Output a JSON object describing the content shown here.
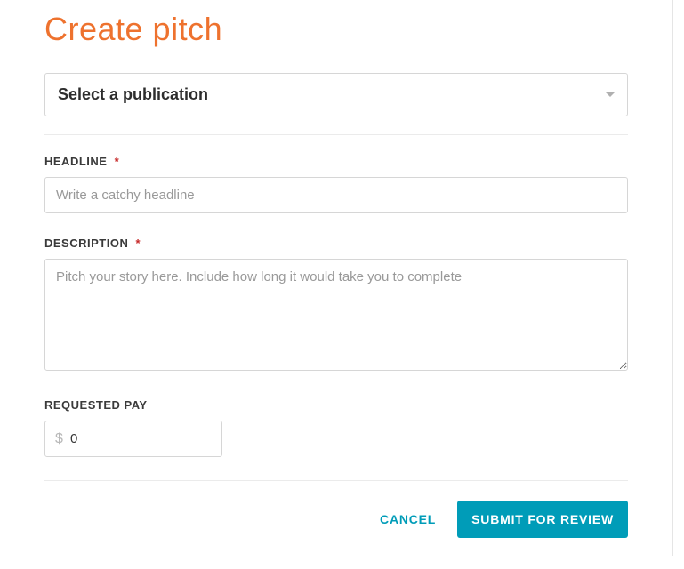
{
  "page": {
    "title": "Create pitch"
  },
  "publication_select": {
    "placeholder": "Select a publication"
  },
  "fields": {
    "headline": {
      "label": "HEADLINE",
      "placeholder": "Write a catchy headline",
      "required": true
    },
    "description": {
      "label": "DESCRIPTION",
      "placeholder": "Pitch your story here. Include how long it would take you to complete",
      "required": true
    },
    "pay": {
      "label": "REQUESTED PAY",
      "currency": "$",
      "value": "0"
    }
  },
  "buttons": {
    "cancel": "CANCEL",
    "submit": "SUBMIT FOR REVIEW"
  },
  "required_mark": "*"
}
